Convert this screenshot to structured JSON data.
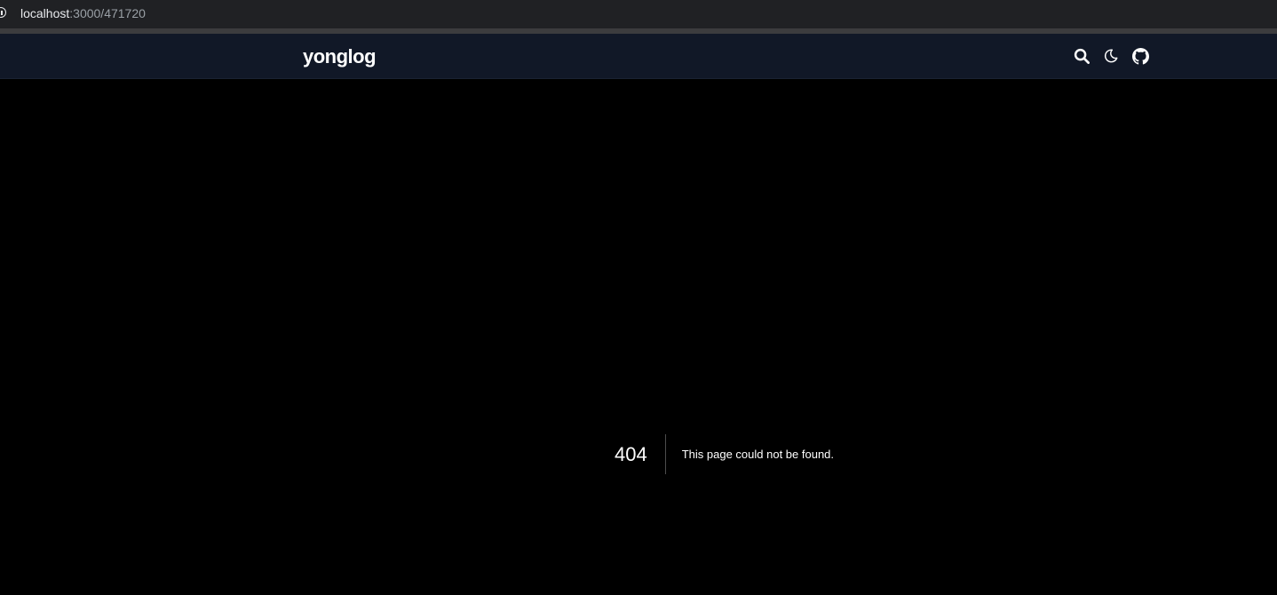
{
  "browser": {
    "url_host": "localhost",
    "url_path": ":3000/471720"
  },
  "header": {
    "logo": "yonglog",
    "icons": [
      "search-icon",
      "moon-icon",
      "github-icon"
    ],
    "background": "#111827"
  },
  "error": {
    "code": "404",
    "message": "This page could not be found."
  },
  "colors": {
    "page_background": "#000000",
    "text": "#ffffff"
  }
}
